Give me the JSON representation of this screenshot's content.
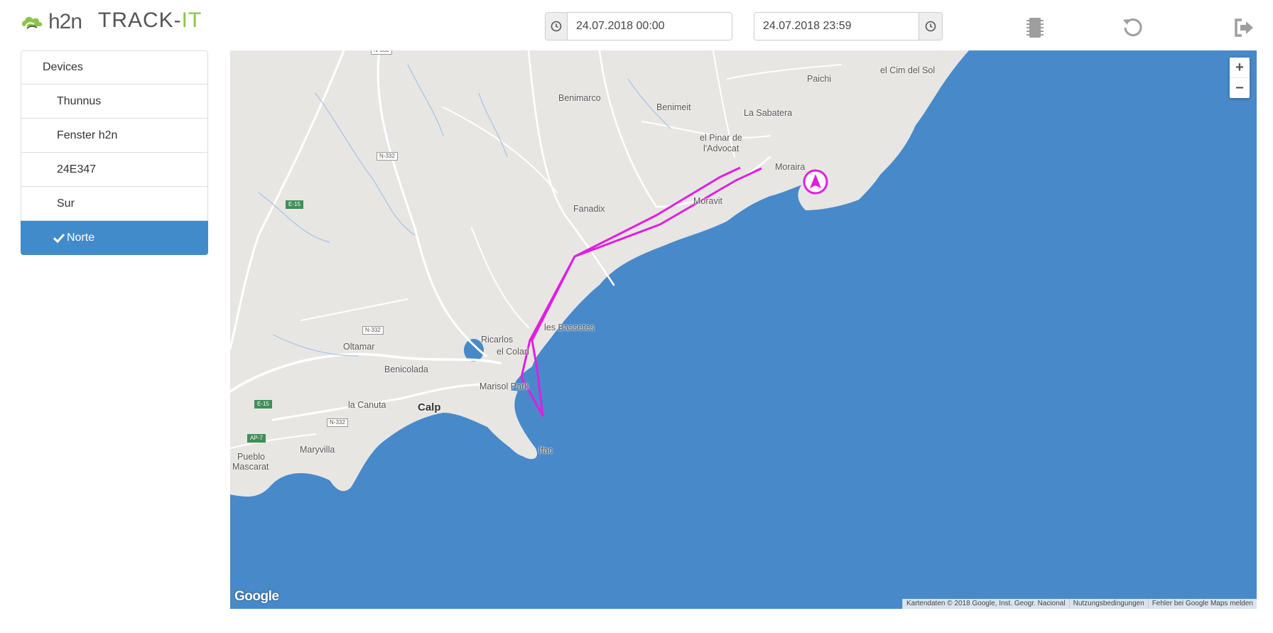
{
  "header": {
    "logo_text": "h2n",
    "app_name_main": "TRACK-",
    "app_name_accent": "IT",
    "date_from": "24.07.2018 00:00",
    "date_to": "24.07.2018 23:59",
    "accent_color": "#8bc34a"
  },
  "icons": {
    "date_from": "clock-icon",
    "date_to": "clock-icon",
    "device": "chip-icon",
    "refresh": "refresh-icon",
    "logout": "logout-icon"
  },
  "sidebar": {
    "header": "Devices",
    "devices": [
      {
        "label": "Thunnus",
        "selected": false
      },
      {
        "label": "Fenster h2n",
        "selected": false
      },
      {
        "label": "24E347",
        "selected": false
      },
      {
        "label": "Sur",
        "selected": false
      },
      {
        "label": "Norte",
        "selected": true
      }
    ],
    "selected_color": "#428bca"
  },
  "map": {
    "places": {
      "paichi": "Paichi",
      "cim_del_sol": "el Cim del Sol",
      "benimarco": "Benimarco",
      "benimeit": "Benimeit",
      "la_sabatera": "La Sabatera",
      "pinar_1": "el Pinar de",
      "pinar_2": "l'Advocat",
      "moraira": "Moraira",
      "moravit": "Moravit",
      "fanadix": "Fanadix",
      "les_bassetes": "les Bassetes",
      "ricarlos": "Ricarlos",
      "el_colari": "el Colari",
      "oltamar": "Oltamar",
      "benicolada": "Benicolada",
      "marisol_park": "Marisol Park",
      "calp": "Calp",
      "la_canuta": "la Canuta",
      "ifac": "Ifac",
      "maryvilla": "Maryvilla",
      "pueblo_1": "Pueblo",
      "pueblo_2": "Mascarat"
    },
    "roads": {
      "n332": "N-332",
      "e15": "E-15",
      "ap7": "AP-7"
    },
    "zoom_in": "+",
    "zoom_out": "−",
    "google": "Google",
    "attribution": "Kartendaten © 2018 Google, Inst. Geogr. Nacional",
    "terms": "Nutzungsbedingungen",
    "report": "Fehler bei Google Maps melden",
    "track_color": "#e01ee0",
    "sea_color": "#4889c9",
    "land_color": "#e8e6e3"
  }
}
